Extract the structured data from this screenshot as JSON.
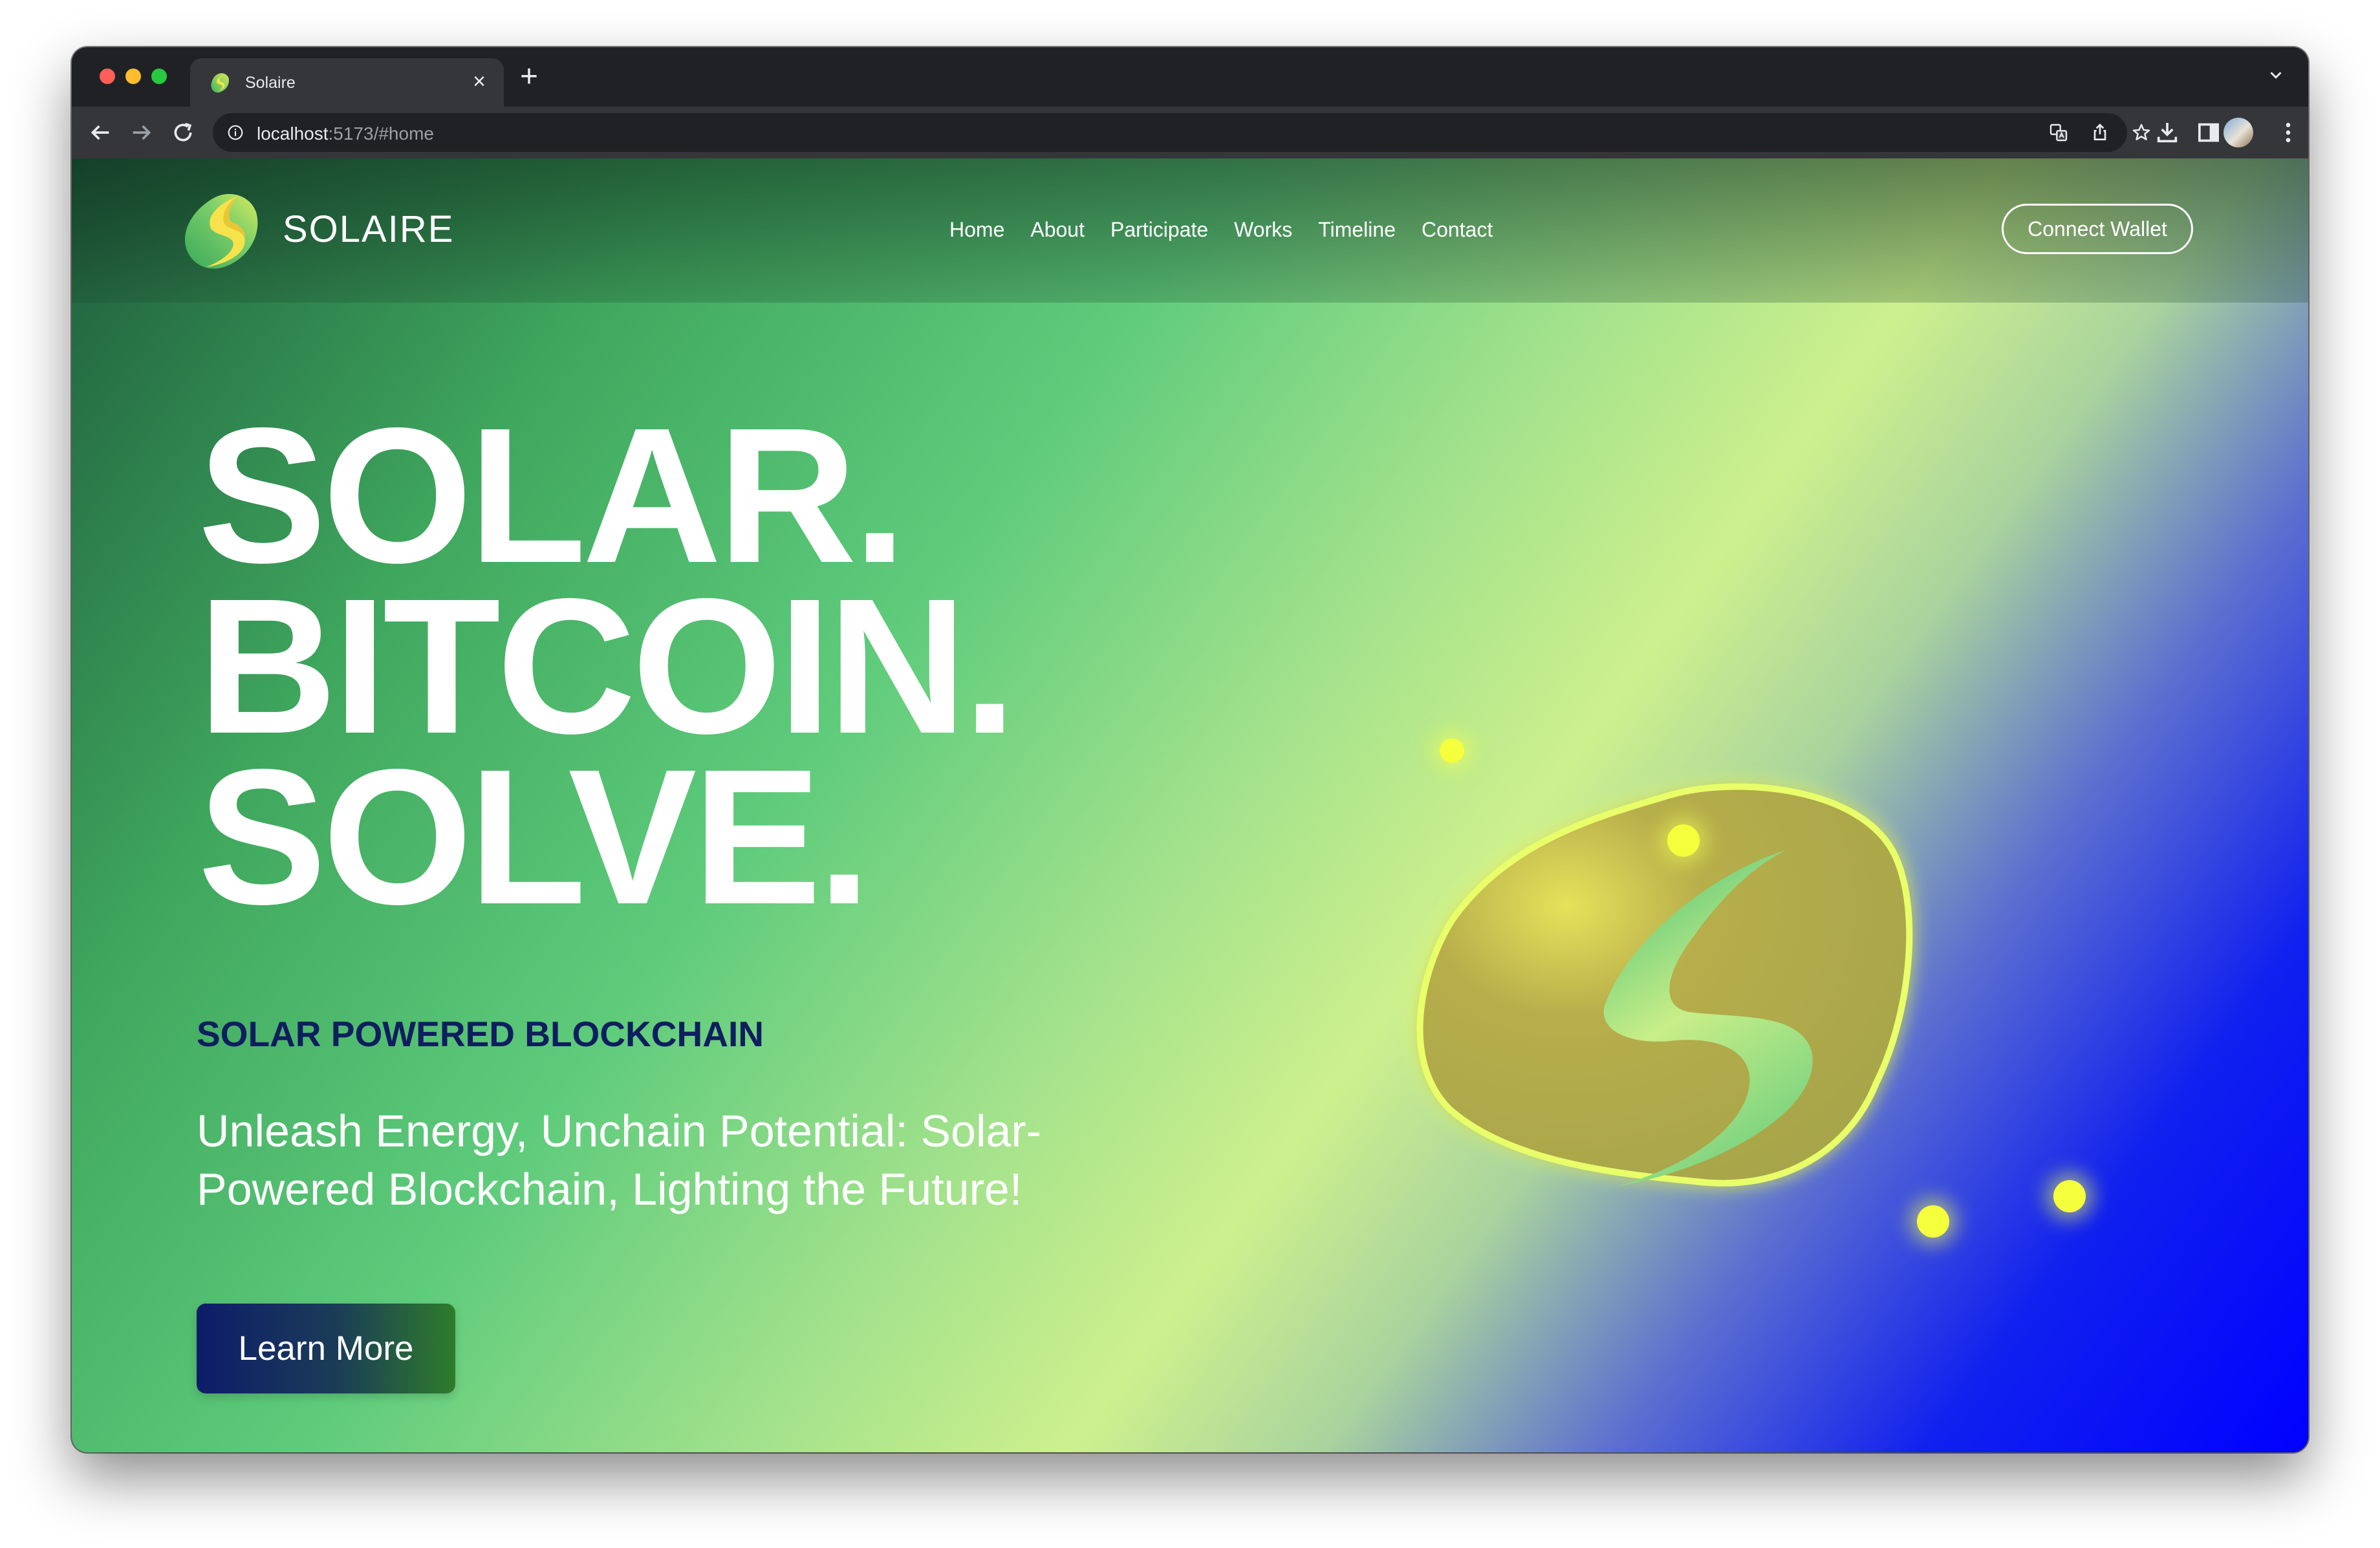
{
  "browser": {
    "tab_title": "Solaire",
    "url_host": "localhost",
    "url_rest": ":5173/#home",
    "icons": [
      "close-icon",
      "plus-icon",
      "chevron-down-icon",
      "back-arrow-icon",
      "forward-arrow-icon",
      "reload-icon",
      "info-icon",
      "translate-icon",
      "share-icon",
      "star-icon",
      "download-icon",
      "sidebar-icon",
      "avatar",
      "more-vert-icon"
    ]
  },
  "site": {
    "brand": "SOLAIRE",
    "nav": [
      "Home",
      "About",
      "Participate",
      "Works",
      "Timeline",
      "Contact"
    ],
    "connect_label": "Connect Wallet"
  },
  "hero": {
    "headline": [
      "SOLAR.",
      "BITCOIN.",
      "SOLVE."
    ],
    "subheading": "SOLAR POWERED BLOCKCHAIN",
    "tagline": "Unleash Energy, Unchain Potential: Solar-Powered Blockchain, Lighting the Future!",
    "cta_label": "Learn More"
  },
  "colors": {
    "subheading": "#0e1e5e",
    "blob": "#aaa84a",
    "glow": "#f5ff3c",
    "gradient_end": "#0000ff"
  }
}
